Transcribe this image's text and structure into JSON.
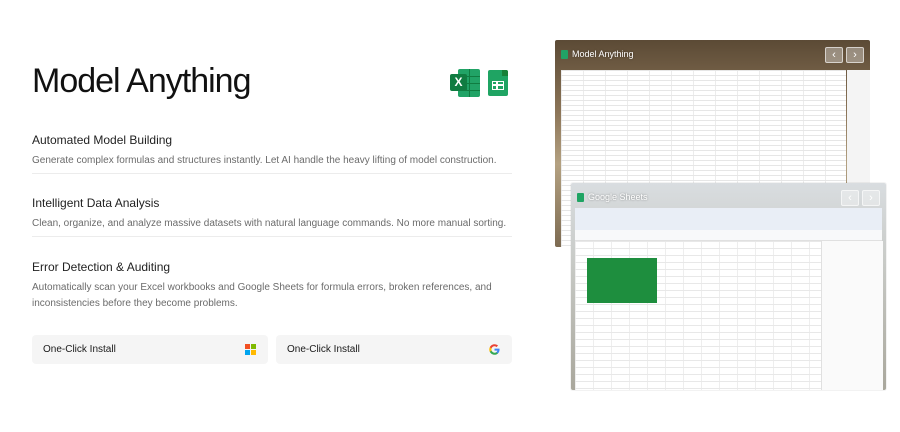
{
  "hero": {
    "title": "Model Anything"
  },
  "features": [
    {
      "title": "Automated Model Building",
      "description": "Generate complex formulas and structures instantly. Let AI handle the heavy lifting of model construction."
    },
    {
      "title": "Intelligent Data Analysis",
      "description": "Clean, organize, and analyze massive datasets with natural language commands. No more manual sorting."
    },
    {
      "title": "Error Detection & Auditing",
      "description": "Automatically scan your Excel workbooks and Google Sheets for formula errors, broken references, and inconsistencies before they become problems."
    }
  ],
  "buttons": {
    "excel_install": {
      "label": "One-Click Install",
      "icon": "microsoft-icon"
    },
    "sheets_install": {
      "label": "One-Click Install",
      "icon": "google-icon"
    }
  },
  "screenshots": {
    "excel": {
      "window_title": "Model Anything"
    },
    "sheets": {
      "window_title": "Google Sheets"
    }
  },
  "icons": {
    "prev": "‹",
    "next": "›",
    "excel_badge": "X"
  },
  "colors": {
    "excel_green": "#107c41",
    "sheets_green": "#1fa463",
    "ms_red": "#f25022",
    "ms_green": "#7fba00",
    "ms_blue": "#00a4ef",
    "ms_yellow": "#ffb900"
  }
}
